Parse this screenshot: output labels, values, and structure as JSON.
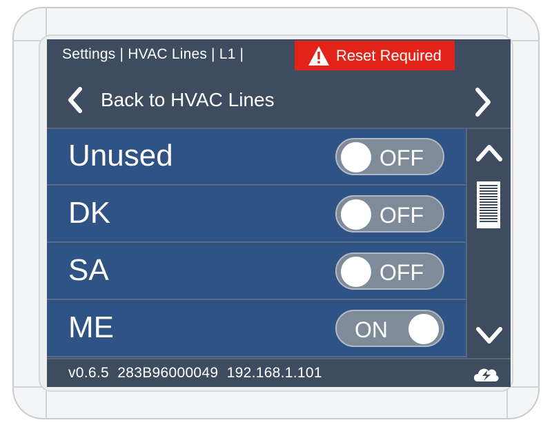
{
  "header": {
    "breadcrumb": "Settings | HVAC Lines | L1 |",
    "alert": {
      "label": "Reset Required",
      "color": "#e2231a",
      "icon": "warning-triangle-icon"
    }
  },
  "nav": {
    "back_label": "Back to HVAC Lines",
    "back_icon": "chevron-left-icon",
    "next_icon": "chevron-right-icon"
  },
  "lines": [
    {
      "label": "Unused",
      "state": "OFF",
      "on": false
    },
    {
      "label": "DK",
      "state": "OFF",
      "on": false
    },
    {
      "label": "SA",
      "state": "OFF",
      "on": false
    },
    {
      "label": "ME",
      "state": "ON",
      "on": true
    }
  ],
  "scrollbar": {
    "up_icon": "chevron-up-icon",
    "down_icon": "chevron-down-icon"
  },
  "footer": {
    "version": "v0.6.5",
    "serial": "283B96000049",
    "ip": "192.168.1.101",
    "logo_icon": "brand-logo-icon"
  },
  "colors": {
    "screen_bg": "#3f4b5e",
    "row_bg": "#2f5385",
    "toggle_bg": "#7f8b99"
  }
}
